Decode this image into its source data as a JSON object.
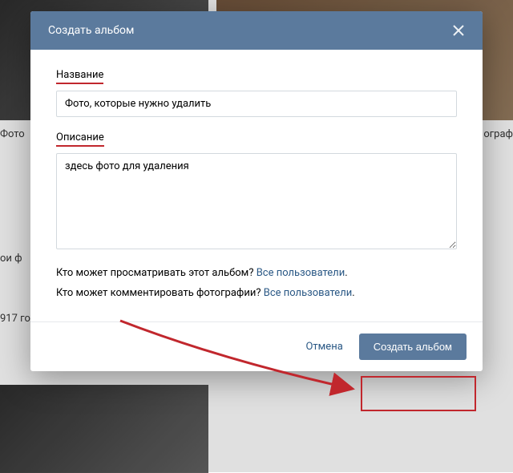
{
  "background": {
    "label_left1": "Фото",
    "label_right1": "ограф",
    "label_left2": "ои ф",
    "label_left3": "917 го"
  },
  "modal": {
    "title": "Создать альбом",
    "name_label": "Название",
    "name_value": "Фото, которые нужно удалить",
    "desc_label": "Описание",
    "desc_value": "здесь фото для удаления",
    "privacy_view_q": "Кто может просматривать этот альбом? ",
    "privacy_view_a": "Все пользователи",
    "privacy_comment_q": "Кто может комментировать фотографии? ",
    "privacy_comment_a": "Все пользователи",
    "dot": ".",
    "cancel": "Отмена",
    "submit": "Создать альбом"
  }
}
